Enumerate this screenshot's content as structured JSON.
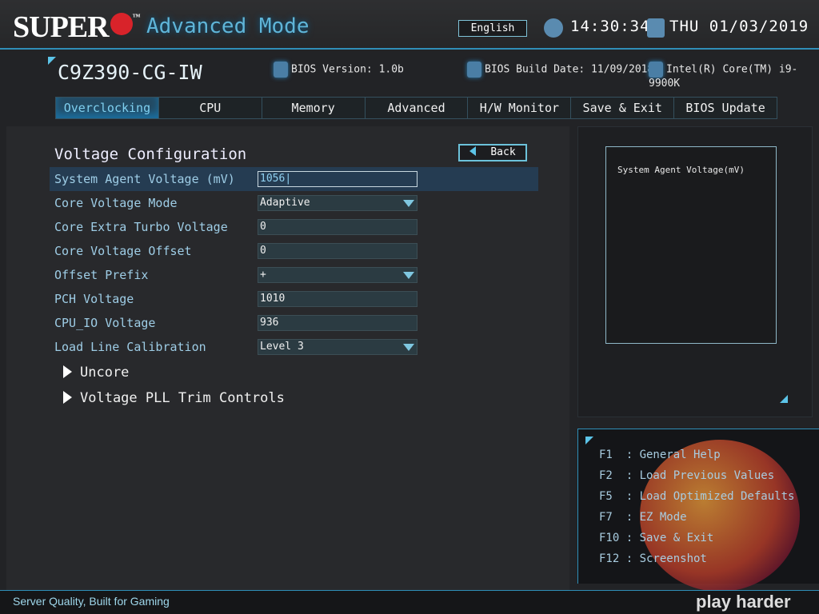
{
  "header": {
    "logo": "SUPER",
    "mode": "Advanced Mode",
    "language": "English",
    "time": "14:30:34",
    "date": "THU 01/03/2019"
  },
  "system": {
    "model": "C9Z390-CG-IW",
    "bios_version": "BIOS Version: 1.0b",
    "build_date": "BIOS Build Date: 11/09/2018",
    "cpu": "Intel(R) Core(TM) i9-9900K"
  },
  "tabs": [
    {
      "label": "Overclocking"
    },
    {
      "label": "CPU"
    },
    {
      "label": "Memory"
    },
    {
      "label": "Advanced"
    },
    {
      "label": "H/W Monitor"
    },
    {
      "label": "Save & Exit"
    },
    {
      "label": "BIOS Update"
    }
  ],
  "main": {
    "title": "Voltage Configuration",
    "back": "Back",
    "settings": [
      {
        "label": "System Agent Voltage (mV)",
        "value": "1056"
      },
      {
        "label": "Core Voltage Mode",
        "value": "Adaptive"
      },
      {
        "label": "Core Extra Turbo Voltage",
        "value": "0"
      },
      {
        "label": "Core Voltage Offset",
        "value": "0"
      },
      {
        "label": "Offset Prefix",
        "value": "+"
      },
      {
        "label": "PCH Voltage",
        "value": "1010"
      },
      {
        "label": "CPU_IO Voltage",
        "value": "936"
      },
      {
        "label": "Load Line Calibration",
        "value": "Level 3"
      }
    ],
    "submenus": [
      {
        "label": "Uncore"
      },
      {
        "label": "Voltage PLL Trim Controls"
      }
    ]
  },
  "help": {
    "text": "System Agent Voltage(mV)"
  },
  "keys": [
    {
      "text": "F1  : General Help"
    },
    {
      "text": "F2  : Load Previous Values"
    },
    {
      "text": "F5  : Load Optimized Defaults"
    },
    {
      "text": "F7  : EZ Mode"
    },
    {
      "text": "F10 : Save & Exit"
    },
    {
      "text": "F12 : Screenshot"
    }
  ],
  "footer": {
    "slogan": "Server Quality, Built for Gaming",
    "brand": "play harder"
  }
}
